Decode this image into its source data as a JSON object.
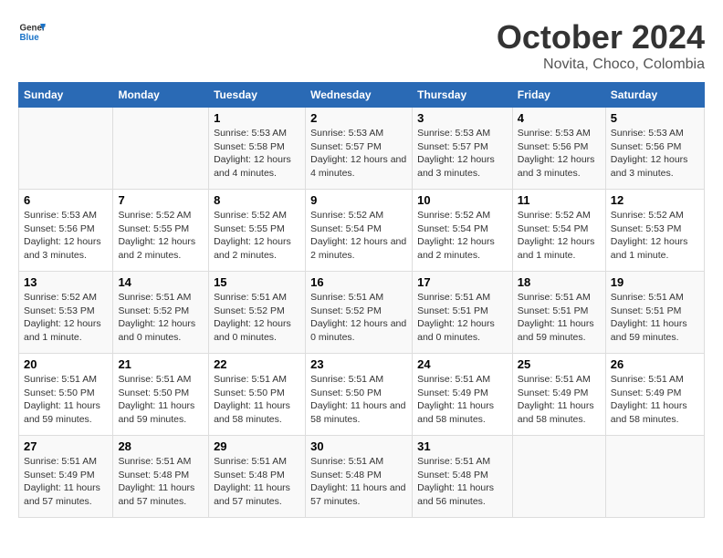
{
  "header": {
    "logo_general": "General",
    "logo_blue": "Blue",
    "title": "October 2024",
    "subtitle": "Novita, Choco, Colombia"
  },
  "days_of_week": [
    "Sunday",
    "Monday",
    "Tuesday",
    "Wednesday",
    "Thursday",
    "Friday",
    "Saturday"
  ],
  "weeks": [
    [
      {
        "day": "",
        "info": ""
      },
      {
        "day": "",
        "info": ""
      },
      {
        "day": "1",
        "sunrise": "Sunrise: 5:53 AM",
        "sunset": "Sunset: 5:58 PM",
        "daylight": "Daylight: 12 hours and 4 minutes."
      },
      {
        "day": "2",
        "sunrise": "Sunrise: 5:53 AM",
        "sunset": "Sunset: 5:57 PM",
        "daylight": "Daylight: 12 hours and 4 minutes."
      },
      {
        "day": "3",
        "sunrise": "Sunrise: 5:53 AM",
        "sunset": "Sunset: 5:57 PM",
        "daylight": "Daylight: 12 hours and 3 minutes."
      },
      {
        "day": "4",
        "sunrise": "Sunrise: 5:53 AM",
        "sunset": "Sunset: 5:56 PM",
        "daylight": "Daylight: 12 hours and 3 minutes."
      },
      {
        "day": "5",
        "sunrise": "Sunrise: 5:53 AM",
        "sunset": "Sunset: 5:56 PM",
        "daylight": "Daylight: 12 hours and 3 minutes."
      }
    ],
    [
      {
        "day": "6",
        "sunrise": "Sunrise: 5:53 AM",
        "sunset": "Sunset: 5:56 PM",
        "daylight": "Daylight: 12 hours and 3 minutes."
      },
      {
        "day": "7",
        "sunrise": "Sunrise: 5:52 AM",
        "sunset": "Sunset: 5:55 PM",
        "daylight": "Daylight: 12 hours and 2 minutes."
      },
      {
        "day": "8",
        "sunrise": "Sunrise: 5:52 AM",
        "sunset": "Sunset: 5:55 PM",
        "daylight": "Daylight: 12 hours and 2 minutes."
      },
      {
        "day": "9",
        "sunrise": "Sunrise: 5:52 AM",
        "sunset": "Sunset: 5:54 PM",
        "daylight": "Daylight: 12 hours and 2 minutes."
      },
      {
        "day": "10",
        "sunrise": "Sunrise: 5:52 AM",
        "sunset": "Sunset: 5:54 PM",
        "daylight": "Daylight: 12 hours and 2 minutes."
      },
      {
        "day": "11",
        "sunrise": "Sunrise: 5:52 AM",
        "sunset": "Sunset: 5:54 PM",
        "daylight": "Daylight: 12 hours and 1 minute."
      },
      {
        "day": "12",
        "sunrise": "Sunrise: 5:52 AM",
        "sunset": "Sunset: 5:53 PM",
        "daylight": "Daylight: 12 hours and 1 minute."
      }
    ],
    [
      {
        "day": "13",
        "sunrise": "Sunrise: 5:52 AM",
        "sunset": "Sunset: 5:53 PM",
        "daylight": "Daylight: 12 hours and 1 minute."
      },
      {
        "day": "14",
        "sunrise": "Sunrise: 5:51 AM",
        "sunset": "Sunset: 5:52 PM",
        "daylight": "Daylight: 12 hours and 0 minutes."
      },
      {
        "day": "15",
        "sunrise": "Sunrise: 5:51 AM",
        "sunset": "Sunset: 5:52 PM",
        "daylight": "Daylight: 12 hours and 0 minutes."
      },
      {
        "day": "16",
        "sunrise": "Sunrise: 5:51 AM",
        "sunset": "Sunset: 5:52 PM",
        "daylight": "Daylight: 12 hours and 0 minutes."
      },
      {
        "day": "17",
        "sunrise": "Sunrise: 5:51 AM",
        "sunset": "Sunset: 5:51 PM",
        "daylight": "Daylight: 12 hours and 0 minutes."
      },
      {
        "day": "18",
        "sunrise": "Sunrise: 5:51 AM",
        "sunset": "Sunset: 5:51 PM",
        "daylight": "Daylight: 11 hours and 59 minutes."
      },
      {
        "day": "19",
        "sunrise": "Sunrise: 5:51 AM",
        "sunset": "Sunset: 5:51 PM",
        "daylight": "Daylight: 11 hours and 59 minutes."
      }
    ],
    [
      {
        "day": "20",
        "sunrise": "Sunrise: 5:51 AM",
        "sunset": "Sunset: 5:50 PM",
        "daylight": "Daylight: 11 hours and 59 minutes."
      },
      {
        "day": "21",
        "sunrise": "Sunrise: 5:51 AM",
        "sunset": "Sunset: 5:50 PM",
        "daylight": "Daylight: 11 hours and 59 minutes."
      },
      {
        "day": "22",
        "sunrise": "Sunrise: 5:51 AM",
        "sunset": "Sunset: 5:50 PM",
        "daylight": "Daylight: 11 hours and 58 minutes."
      },
      {
        "day": "23",
        "sunrise": "Sunrise: 5:51 AM",
        "sunset": "Sunset: 5:50 PM",
        "daylight": "Daylight: 11 hours and 58 minutes."
      },
      {
        "day": "24",
        "sunrise": "Sunrise: 5:51 AM",
        "sunset": "Sunset: 5:49 PM",
        "daylight": "Daylight: 11 hours and 58 minutes."
      },
      {
        "day": "25",
        "sunrise": "Sunrise: 5:51 AM",
        "sunset": "Sunset: 5:49 PM",
        "daylight": "Daylight: 11 hours and 58 minutes."
      },
      {
        "day": "26",
        "sunrise": "Sunrise: 5:51 AM",
        "sunset": "Sunset: 5:49 PM",
        "daylight": "Daylight: 11 hours and 58 minutes."
      }
    ],
    [
      {
        "day": "27",
        "sunrise": "Sunrise: 5:51 AM",
        "sunset": "Sunset: 5:49 PM",
        "daylight": "Daylight: 11 hours and 57 minutes."
      },
      {
        "day": "28",
        "sunrise": "Sunrise: 5:51 AM",
        "sunset": "Sunset: 5:48 PM",
        "daylight": "Daylight: 11 hours and 57 minutes."
      },
      {
        "day": "29",
        "sunrise": "Sunrise: 5:51 AM",
        "sunset": "Sunset: 5:48 PM",
        "daylight": "Daylight: 11 hours and 57 minutes."
      },
      {
        "day": "30",
        "sunrise": "Sunrise: 5:51 AM",
        "sunset": "Sunset: 5:48 PM",
        "daylight": "Daylight: 11 hours and 57 minutes."
      },
      {
        "day": "31",
        "sunrise": "Sunrise: 5:51 AM",
        "sunset": "Sunset: 5:48 PM",
        "daylight": "Daylight: 11 hours and 56 minutes."
      },
      {
        "day": "",
        "info": ""
      },
      {
        "day": "",
        "info": ""
      }
    ]
  ]
}
